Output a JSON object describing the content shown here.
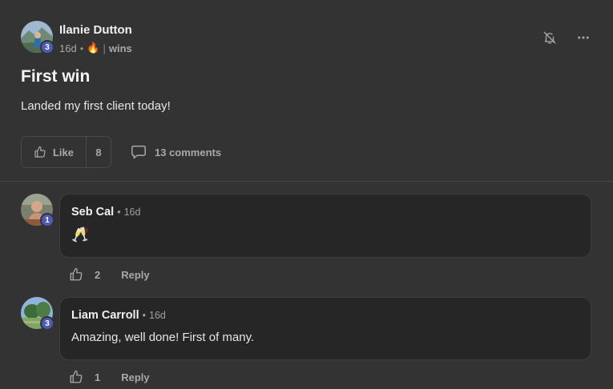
{
  "post": {
    "author": {
      "name": "Ilanie Dutton",
      "level": "3"
    },
    "time": "16d",
    "streak_emoji": "🔥",
    "meta_separator": "•",
    "category_separator": "|",
    "category": "wins",
    "title": "First win",
    "body": "Landed my first client today!",
    "like_label": "Like",
    "like_count": "8",
    "comments_label": "13 comments"
  },
  "header_icons": [
    "bell-off-icon",
    "more-options-icon"
  ],
  "comments": [
    {
      "author": "Seb Cal",
      "level": "1",
      "time_prefix": "•",
      "time": "16d",
      "text": "🥂",
      "like_count": "2",
      "reply_label": "Reply"
    },
    {
      "author": "Liam Carroll",
      "level": "3",
      "time_prefix": "•",
      "time": "16d",
      "text": "Amazing, well done! First of many.",
      "like_count": "1",
      "reply_label": "Reply"
    }
  ],
  "colors": {
    "background": "#333333",
    "bubble": "#262626",
    "badge": "#4e5bb4",
    "muted_text": "#a8a8a8"
  }
}
